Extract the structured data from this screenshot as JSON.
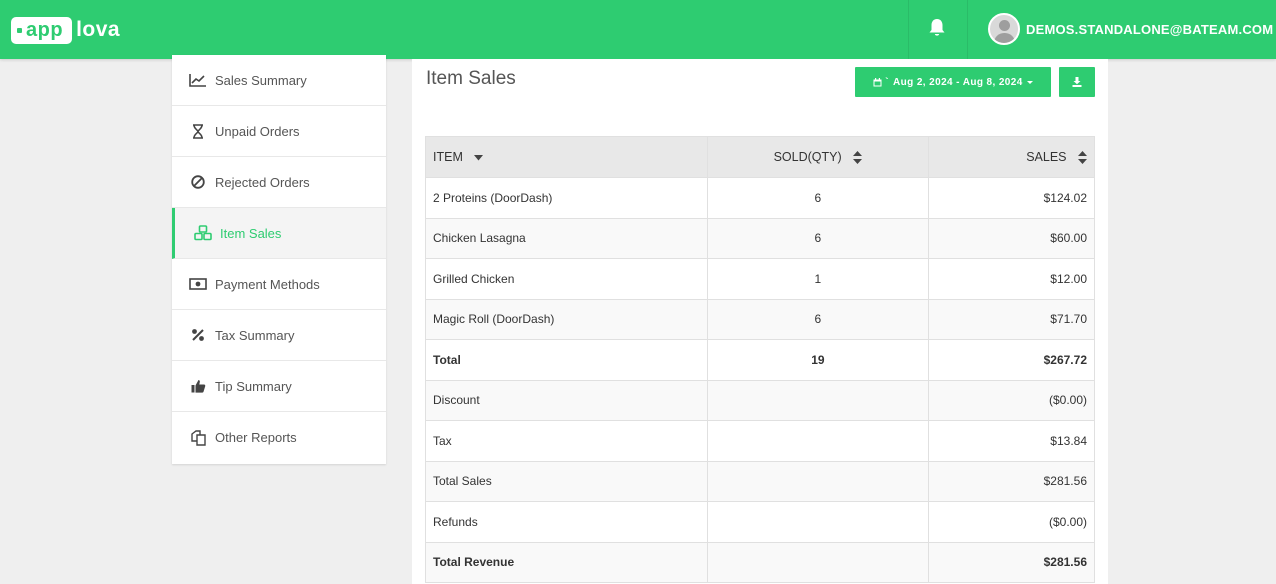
{
  "app": {
    "logo_text_1": "app",
    "logo_text_2": "lova",
    "user_email": "DEMOS.STANDALONE@BATEAM.COM"
  },
  "colors": {
    "brand": "#2ecc71",
    "background": "#efefef"
  },
  "sidebar": {
    "items": [
      {
        "label": "Sales Summary",
        "icon": "line-chart-icon",
        "active": false
      },
      {
        "label": "Unpaid Orders",
        "icon": "hourglass-icon",
        "active": false
      },
      {
        "label": "Rejected Orders",
        "icon": "ban-icon",
        "active": false
      },
      {
        "label": "Item Sales",
        "icon": "cubes-icon",
        "active": true
      },
      {
        "label": "Payment Methods",
        "icon": "money-icon",
        "active": false
      },
      {
        "label": "Tax Summary",
        "icon": "percent-icon",
        "active": false
      },
      {
        "label": "Tip Summary",
        "icon": "thumbs-up-icon",
        "active": false
      },
      {
        "label": "Other Reports",
        "icon": "copy-icon",
        "active": false
      }
    ]
  },
  "main": {
    "title": "Item Sales",
    "date_range": "Aug 2, 2024 - Aug 8, 2024",
    "table": {
      "headers": [
        "ITEM",
        "SOLD(QTY)",
        "SALES"
      ],
      "rows": [
        {
          "item": "2 Proteins (DoorDash)",
          "qty": "6",
          "sales": "$124.02"
        },
        {
          "item": "Chicken Lasagna",
          "qty": "6",
          "sales": "$60.00"
        },
        {
          "item": "Grilled Chicken",
          "qty": "1",
          "sales": "$12.00"
        },
        {
          "item": "Magic Roll (DoorDash)",
          "qty": "6",
          "sales": "$71.70"
        }
      ],
      "total": {
        "label": "Total",
        "qty": "19",
        "sales": "$267.72"
      },
      "summary": [
        {
          "label": "Discount",
          "value": "($0.00)"
        },
        {
          "label": "Tax",
          "value": "$13.84"
        },
        {
          "label": "Total Sales",
          "value": "$281.56"
        },
        {
          "label": "Refunds",
          "value": "($0.00)"
        }
      ],
      "total_revenue": {
        "label": "Total Revenue",
        "value": "$281.56"
      }
    }
  }
}
